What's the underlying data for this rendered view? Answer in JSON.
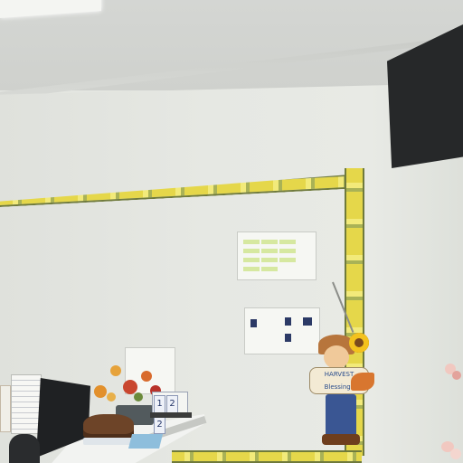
{
  "scene": {
    "description_tags": [],
    "scarecrow_sign_text": "HARVEST Blessings",
    "date_digits": [
      "1",
      "2",
      "2"
    ]
  },
  "colors": {
    "wall": "#e6e8e3",
    "ceiling": "#d2d4d0",
    "border_yellow": "#e5d74a",
    "tv_black": "#262829",
    "desk_white": "#f2f3f1",
    "scarecrow_pants": "#3a5693",
    "sunflower": "#f3c21e"
  }
}
